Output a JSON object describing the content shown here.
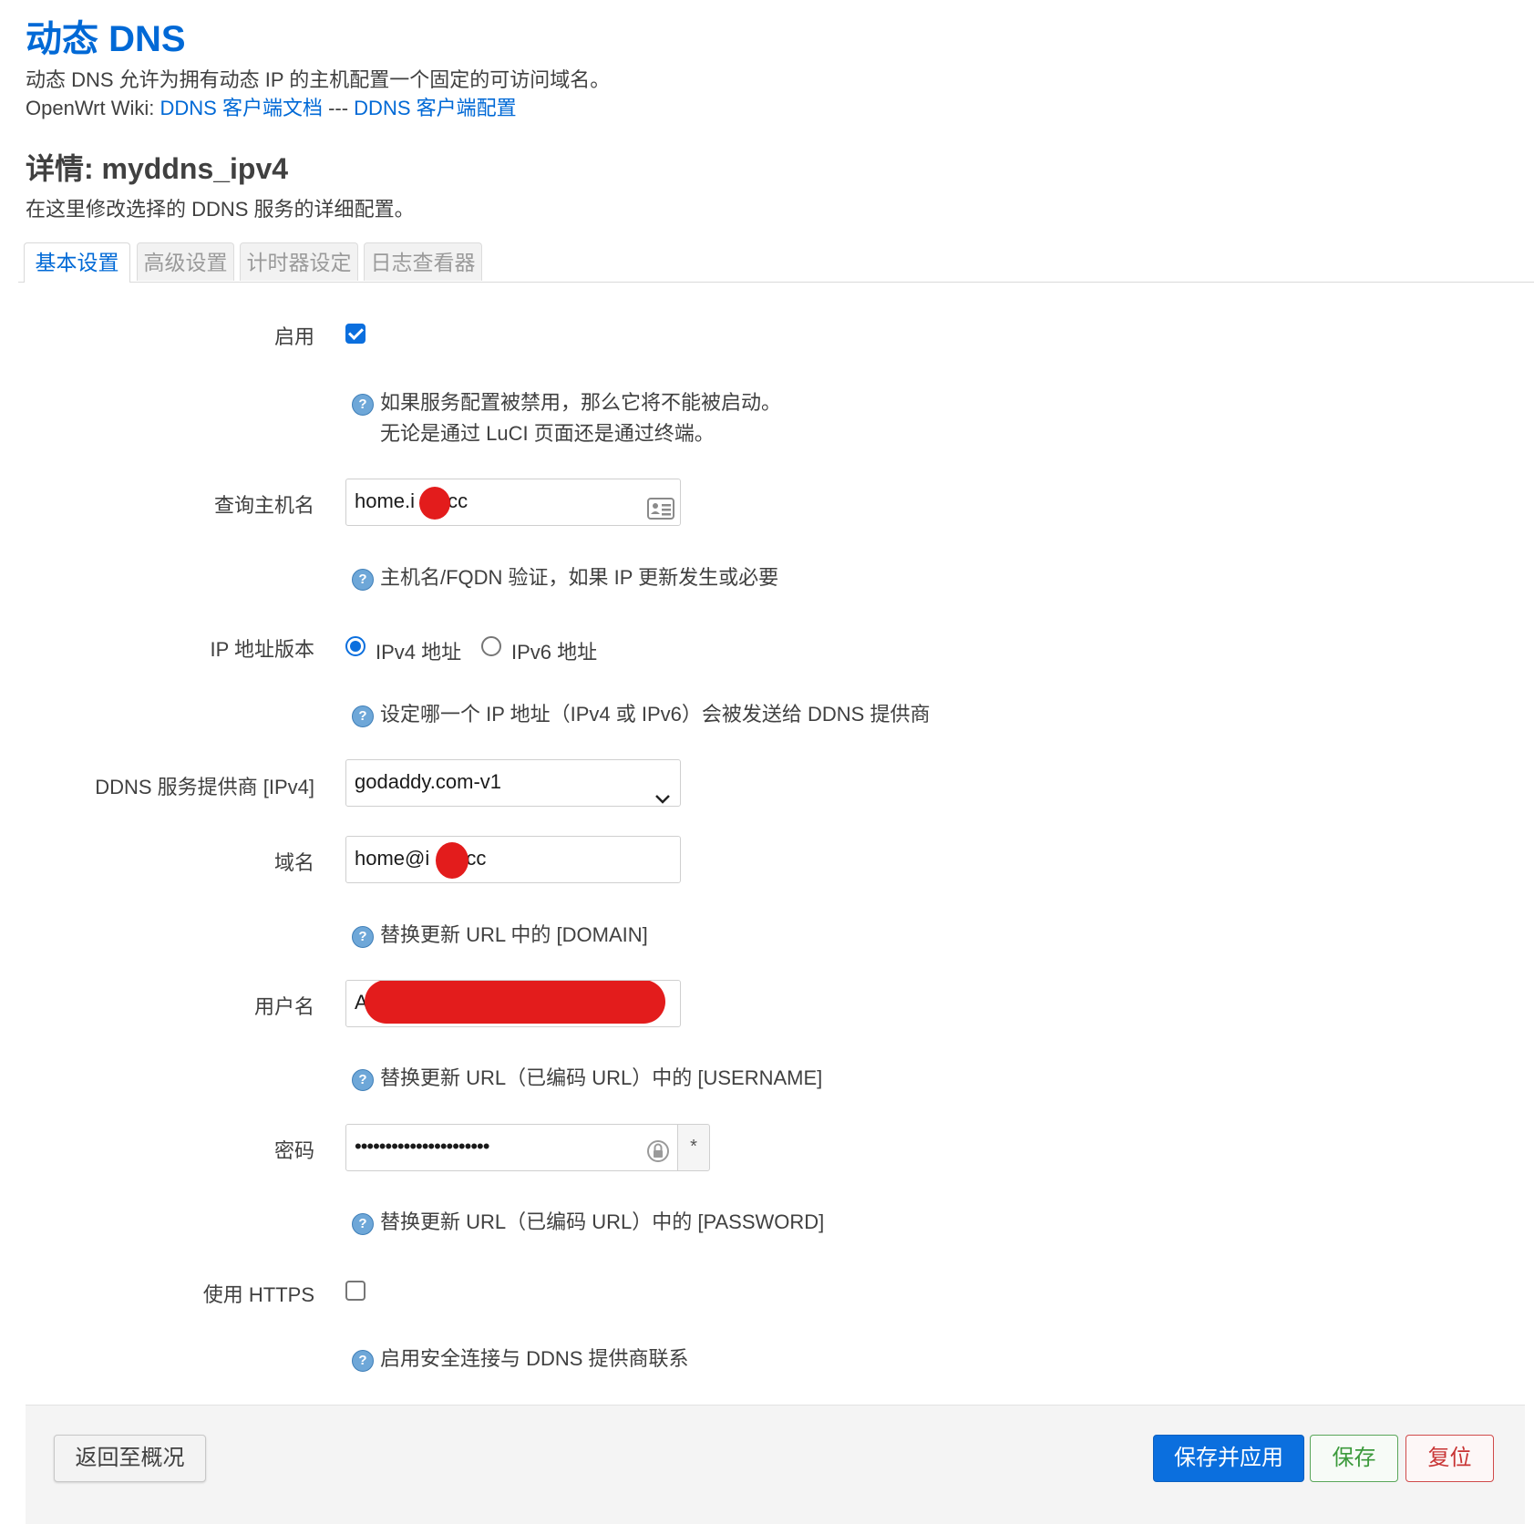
{
  "header": {
    "title": "动态 DNS",
    "description": "动态 DNS 允许为拥有动态 IP 的主机配置一个固定的可访问域名。",
    "wiki_prefix": "OpenWrt Wiki: ",
    "wiki_link1": "DDNS 客户端文档",
    "wiki_separator": " --- ",
    "wiki_link2": "DDNS 客户端配置"
  },
  "section": {
    "title": "详情: myddns_ipv4",
    "description": "在这里修改选择的 DDNS 服务的详细配置。"
  },
  "tabs": [
    "基本设置",
    "高级设置",
    "计时器设定",
    "日志查看器"
  ],
  "active_tab": "基本设置",
  "form": {
    "enable": {
      "label": "启用",
      "checked": true,
      "hint1": "如果服务配置被禁用，那么它将不能被启动。",
      "hint2": "无论是通过 LuCI 页面还是通过终端。"
    },
    "lookup_host": {
      "label": "查询主机名",
      "value_prefix": "home.i",
      "value_suffix": ".cc",
      "hint": "主机名/FQDN 验证，如果 IP 更新发生或必要"
    },
    "ip_version": {
      "label": "IP 地址版本",
      "option1": "IPv4 地址",
      "option2": "IPv6 地址",
      "selected": "IPv4 地址",
      "hint": "设定哪一个 IP 地址（IPv4 或 IPv6）会被发送给 DDNS 提供商"
    },
    "service": {
      "label": "DDNS 服务提供商 [IPv4]",
      "value": "godaddy.com-v1"
    },
    "domain": {
      "label": "域名",
      "value_prefix": "home@i",
      "value_suffix": ".cc",
      "hint": "替换更新 URL 中的 [DOMAIN]"
    },
    "username": {
      "label": "用户名",
      "value_prefix": "A",
      "hint": "替换更新 URL（已编码 URL）中的 [USERNAME]"
    },
    "password": {
      "label": "密码",
      "value": "••••••••••••••••••••••",
      "reveal_label": "*",
      "hint": "替换更新 URL（已编码 URL）中的 [PASSWORD]"
    },
    "https": {
      "label": "使用 HTTPS",
      "checked": false,
      "hint": "启用安全连接与 DDNS 提供商联系"
    }
  },
  "footer": {
    "back_label": "返回至概况",
    "save_apply_label": "保存并应用",
    "save_label": "保存",
    "reset_label": "复位"
  },
  "colors": {
    "accent": "#0069d6",
    "primary_button": "#0b6fde",
    "save": "#3c9a3c",
    "reset": "#c83333",
    "redaction": "#e31c1c"
  }
}
